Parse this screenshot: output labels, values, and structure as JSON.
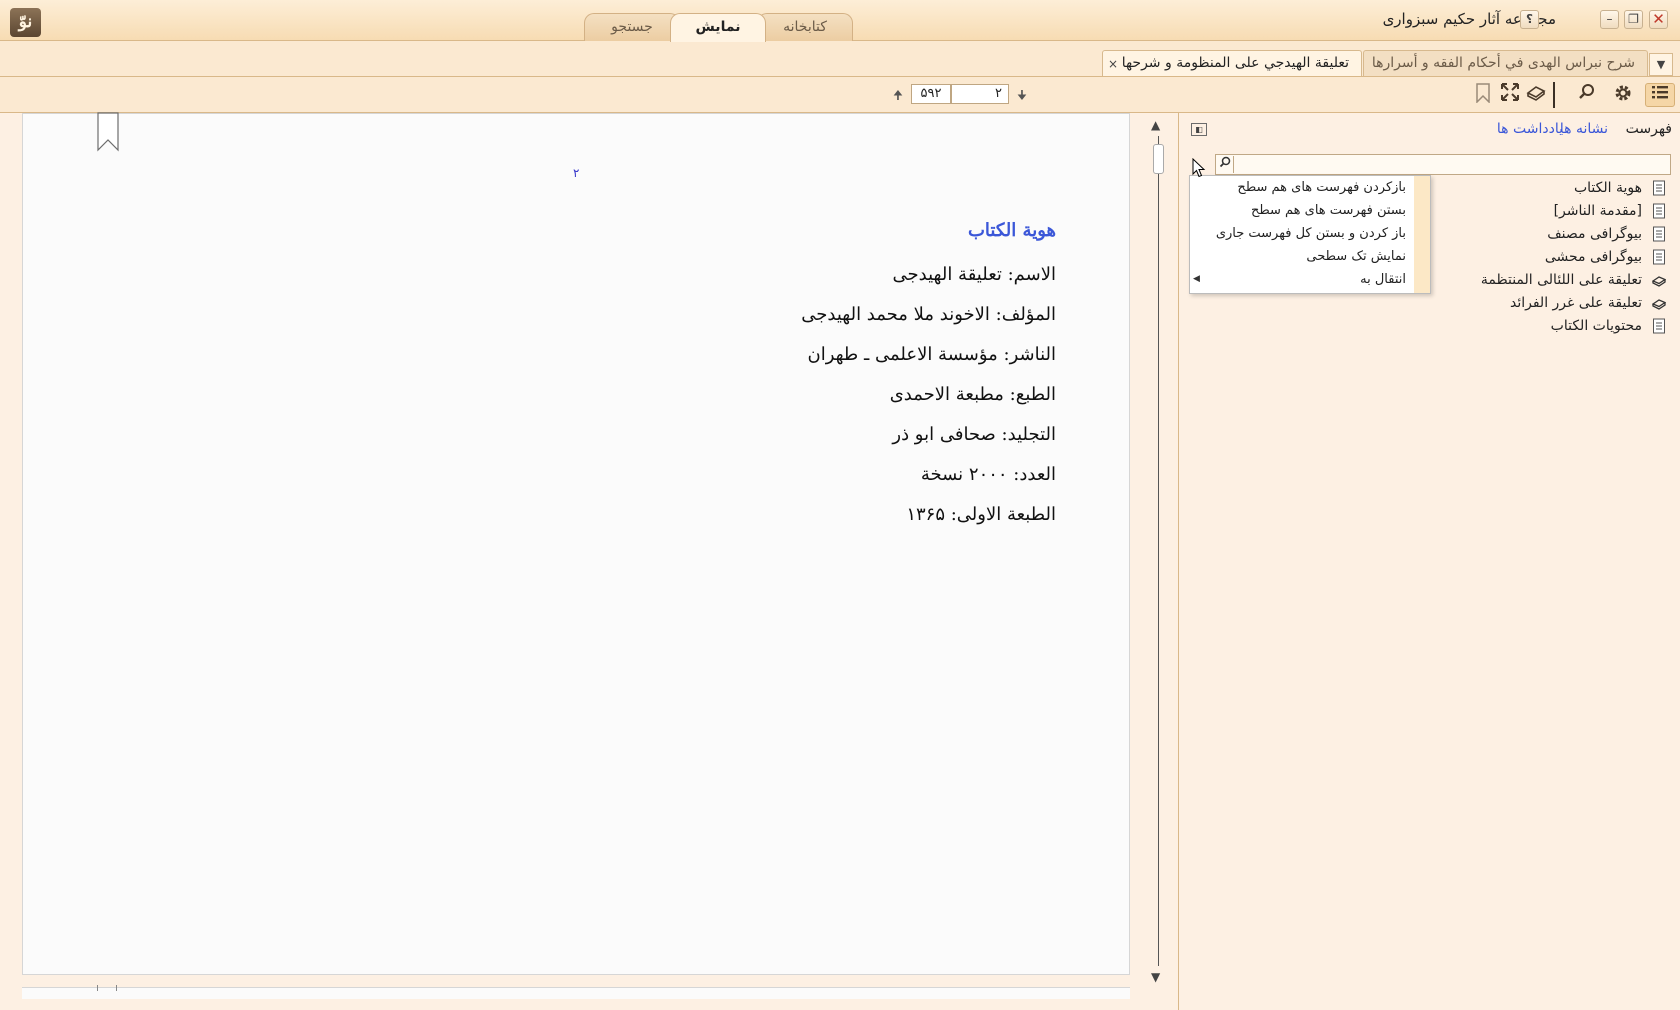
{
  "app": {
    "title": "مجموعه آثار حکیم سبزواری",
    "logo_text": "نوّ"
  },
  "window_controls": {
    "help": "؟",
    "minimize": "–",
    "restore": "❐",
    "close": "✕"
  },
  "main_tabs": [
    {
      "label": "جستجو",
      "active": false
    },
    {
      "label": "نمایش",
      "active": true
    },
    {
      "label": "کتابخانه",
      "active": false
    }
  ],
  "doc_tabs": {
    "active": "تعليقة الهيدجي على المنظومة و شرحها",
    "inactive": "شرح نبراس الهدى في أحكام الفقه و أسرارها",
    "close": "×",
    "dropdown": "▼"
  },
  "toolbar": {
    "page_current": "۲",
    "page_total": "۵۹۲",
    "up_arrow": "🠉",
    "down_arrow": "🠋",
    "icons": [
      "bookmark-icon",
      "fullscreen-icon",
      "notebook-icon",
      "search-icon",
      "settings-icon",
      "list-icon"
    ]
  },
  "page": {
    "number": "۲",
    "heading": "هوية الكتاب",
    "lines": [
      "الاسم: تعليقة الهيدجى",
      "المؤلف: الاخوند ملا محمد الهيدجى",
      "الناشر: مؤسسة الاعلمى ـ طهران",
      "الطبع: مطبعة الاحمدى",
      "التجليد: صحافى ابو ذر",
      "العدد: ۲۰۰۰ نسخة",
      "الطبعة الاولى: ۱۳۶۵"
    ]
  },
  "scrollbar": {
    "up": "▲",
    "down": "▼"
  },
  "sidebar": {
    "tabs": {
      "index": "فهرست",
      "bookmarks": "نشانه ها",
      "notes": "يادداشت ها"
    },
    "search_placeholder": "",
    "items": [
      {
        "label": "هوية الكتاب",
        "icon": "page-icon"
      },
      {
        "label": "[مقدمة الناشر]",
        "icon": "page-icon"
      },
      {
        "label": "بیوگرافی مصنف",
        "icon": "page-icon"
      },
      {
        "label": "بیوگرافی محشی",
        "icon": "page-icon"
      },
      {
        "label": "تعليقة على اللئالى المنتظمة",
        "icon": "book-icon"
      },
      {
        "label": "تعليقة على غرر الفرائد",
        "icon": "book-icon"
      },
      {
        "label": "محتويات الكتاب",
        "icon": "page-icon"
      }
    ]
  },
  "context_menu": {
    "items": [
      "بازکردن فهرست های هم سطح",
      "بستن فهرست های هم سطح",
      "باز کردن و بستن کل فهرست جاری",
      "نمایش تک سطحی",
      "انتقال به"
    ],
    "submenu_arrow": "◀"
  }
}
